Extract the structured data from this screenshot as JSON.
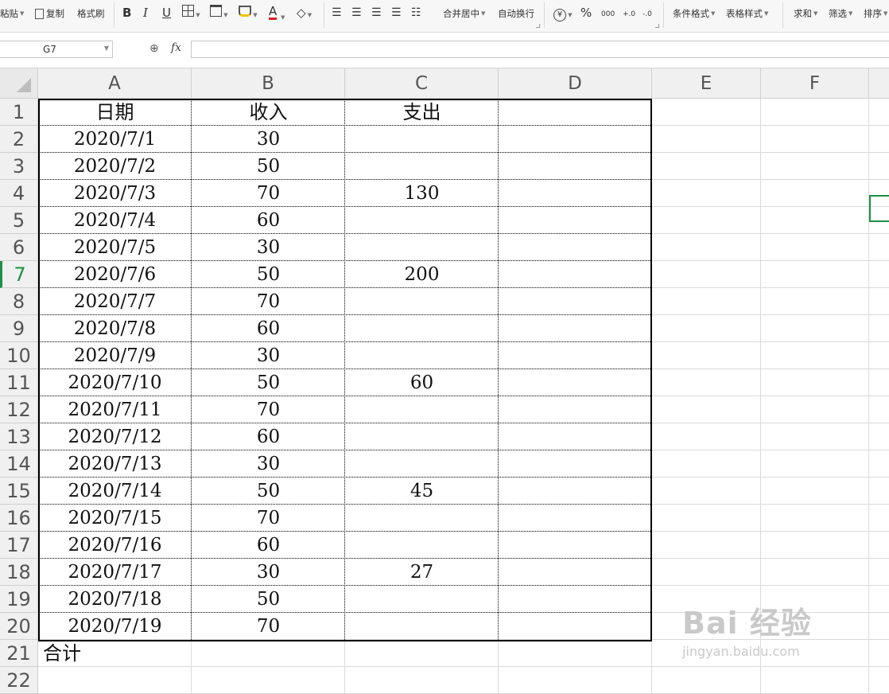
{
  "ribbon": {
    "paste": "粘贴",
    "copy": "复制",
    "format_painter": "格式刷",
    "bold": "B",
    "italic": "I",
    "underline": "U",
    "font_color_glyph": "A",
    "merge_center": "合并居中",
    "wrap_text": "自动换行",
    "currency_glyph": "¥",
    "percent": "%",
    "thousands": "000",
    "inc_decimal": "+.0",
    "dec_decimal": "-.0",
    "conditional_format": "条件格式",
    "table_style": "表格样式",
    "sum": "求和",
    "filter": "筛选",
    "sort": "排序",
    "icons": [
      "paste-icon",
      "copy-icon",
      "borders-icon",
      "fill-color-icon",
      "eraser-icon",
      "align-icons",
      "currency-icon"
    ]
  },
  "formula_bar": {
    "name_box": "G7",
    "fx_label": "fx",
    "formula": ""
  },
  "sheet": {
    "columns": [
      "A",
      "B",
      "C",
      "D",
      "E",
      "F"
    ],
    "rows": [
      "1",
      "2",
      "3",
      "4",
      "5",
      "6",
      "7",
      "8",
      "9",
      "10",
      "11",
      "12",
      "13",
      "14",
      "15",
      "16",
      "17",
      "18",
      "19",
      "20",
      "21",
      "22"
    ],
    "headers": {
      "a": "日期",
      "b": "收入",
      "c": "支出"
    },
    "data": [
      {
        "a": "2020/7/1",
        "b": "30",
        "c": ""
      },
      {
        "a": "2020/7/2",
        "b": "50",
        "c": ""
      },
      {
        "a": "2020/7/3",
        "b": "70",
        "c": "130"
      },
      {
        "a": "2020/7/4",
        "b": "60",
        "c": ""
      },
      {
        "a": "2020/7/5",
        "b": "30",
        "c": ""
      },
      {
        "a": "2020/7/6",
        "b": "50",
        "c": "200"
      },
      {
        "a": "2020/7/7",
        "b": "70",
        "c": ""
      },
      {
        "a": "2020/7/8",
        "b": "60",
        "c": ""
      },
      {
        "a": "2020/7/9",
        "b": "30",
        "c": ""
      },
      {
        "a": "2020/7/10",
        "b": "50",
        "c": "60"
      },
      {
        "a": "2020/7/11",
        "b": "70",
        "c": ""
      },
      {
        "a": "2020/7/12",
        "b": "60",
        "c": ""
      },
      {
        "a": "2020/7/13",
        "b": "30",
        "c": ""
      },
      {
        "a": "2020/7/14",
        "b": "50",
        "c": "45"
      },
      {
        "a": "2020/7/15",
        "b": "70",
        "c": ""
      },
      {
        "a": "2020/7/16",
        "b": "60",
        "c": ""
      },
      {
        "a": "2020/7/17",
        "b": "30",
        "c": "27"
      },
      {
        "a": "2020/7/18",
        "b": "50",
        "c": ""
      },
      {
        "a": "2020/7/19",
        "b": "70",
        "c": ""
      }
    ],
    "total_label": "合计",
    "active_row": "7",
    "selection_color": "#1e8f46"
  },
  "watermark": {
    "line1": "Bai 经验",
    "line2": "jingyan.baidu.com"
  }
}
